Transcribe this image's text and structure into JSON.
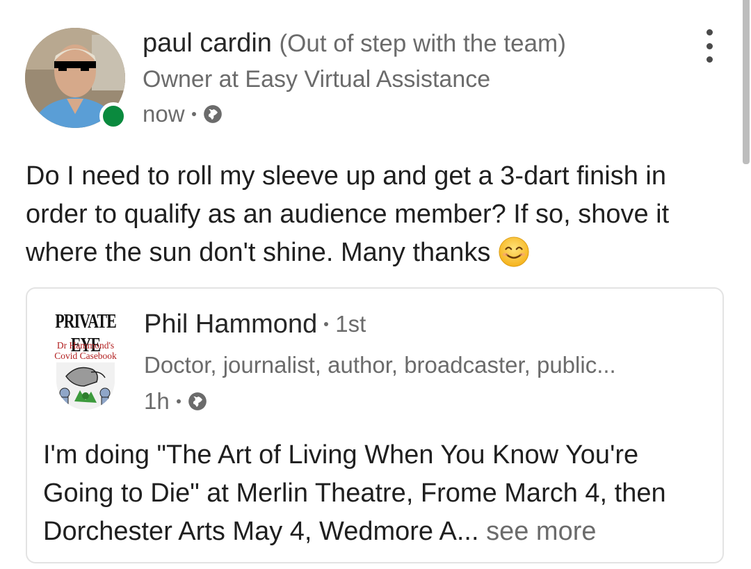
{
  "post": {
    "author": {
      "name": "paul cardin",
      "tagline": "(Out of step with the team)",
      "headline": "Owner at Easy Virtual Assistance",
      "time": "now",
      "visibility_icon": "globe-icon",
      "online": true,
      "presence_color": "#0a8a3e"
    },
    "menu_icon": "more-vertical-icon",
    "text": "Do I need to roll my sleeve up and get a 3-dart finish in order to qualify as an audience member? If so, shove it where the sun don't shine. Many thanks",
    "emoji": "smiling-face-emoji"
  },
  "shared_post": {
    "author": {
      "name": "Phil Hammond",
      "degree": "1st",
      "headline": "Doctor, journalist, author, broadcaster, public...",
      "time": "1h",
      "visibility_icon": "globe-icon",
      "avatar_logo_text": "PRIVATE EYE",
      "avatar_caption": "Dr Hammond's Covid Casebook"
    },
    "text": "I'm doing \"The Art of Living When You Know You're Going to Die\" at Merlin Theatre, Frome March 4, then Dorchester Arts May 4, Wedmore A...",
    "see_more_label": "see more"
  }
}
